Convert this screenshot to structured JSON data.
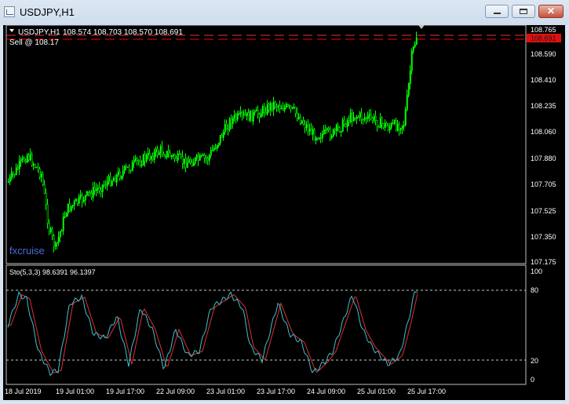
{
  "window": {
    "title": "USDJPY,H1",
    "buttons": {
      "minimize": "minimize",
      "maximize": "maximize",
      "close": "✕"
    }
  },
  "main": {
    "symbol_header": "USDJPY,H1",
    "ohlc": "108.574 108.703 108.570 108.691",
    "order_label": "Sell @ 108.17",
    "watermark": "fxcruise",
    "price_axis": [
      "108.765",
      "108.590",
      "108.410",
      "108.235",
      "108.060",
      "107.880",
      "107.705",
      "107.525",
      "107.350",
      "107.175"
    ],
    "bid_price": "108.691",
    "colors": {
      "candle": "#00ff00",
      "background": "#000000",
      "sell_line": "#ff0000",
      "bid_line": "#d23b3b"
    }
  },
  "indicator": {
    "label": "Sto(5,3,3) 98.6391 96.1397",
    "levels": [
      "100",
      "80",
      "20",
      "0"
    ],
    "colors": {
      "main": "#40c0d0",
      "signal": "#e03030",
      "levels": "#c8c8c8"
    }
  },
  "time_axis": [
    "18 Jul 2019",
    "19 Jul 01:00",
    "19 Jul 17:00",
    "22 Jul 09:00",
    "23 Jul 01:00",
    "23 Jul 17:00",
    "24 Jul 09:00",
    "25 Jul 01:00",
    "25 Jul 17:00"
  ]
}
